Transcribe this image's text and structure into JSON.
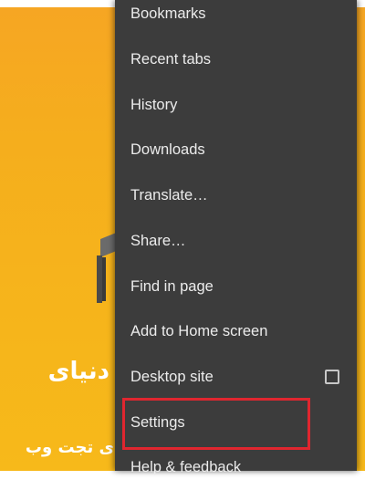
{
  "background_page": {
    "headline_text": "ر دنیای",
    "subline_text": "ی تجت وب",
    "accent_color": "#f6a623"
  },
  "menu": {
    "items": [
      {
        "label": "Bookmarks"
      },
      {
        "label": "Recent tabs"
      },
      {
        "label": "History"
      },
      {
        "label": "Downloads"
      },
      {
        "label": "Translate…"
      },
      {
        "label": "Share…"
      },
      {
        "label": "Find in page"
      },
      {
        "label": "Add to Home screen"
      },
      {
        "label": "Desktop site",
        "checkbox_checked": false
      },
      {
        "label": "Settings",
        "highlighted": true
      },
      {
        "label": "Help & feedback"
      }
    ],
    "background_color": "#3c3c3c",
    "text_color": "#ececec"
  },
  "annotation": {
    "highlight_color": "#e0262f",
    "target": "Settings"
  }
}
